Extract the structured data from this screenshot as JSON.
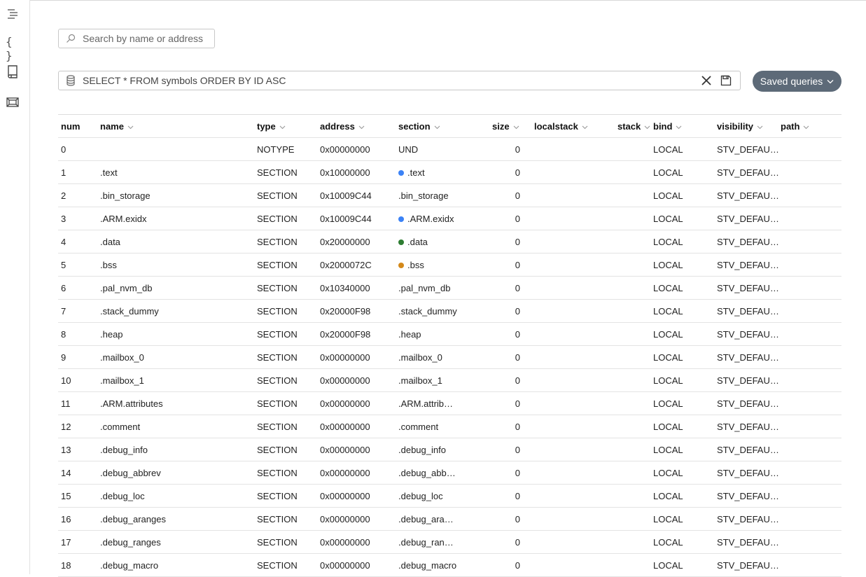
{
  "search": {
    "placeholder": "Search by name or address"
  },
  "query": {
    "value": "SELECT * FROM symbols ORDER BY ID ASC"
  },
  "saved_queries_label": "Saved queries",
  "colors": {
    "text_blue": "#3b82f6",
    "data_green": "#2e7d32",
    "bss_orange": "#d4891a",
    "button_bg": "#5d6a78"
  },
  "columns": {
    "num": "num",
    "name": "name",
    "type": "type",
    "address": "address",
    "section": "section",
    "size": "size",
    "localstack": "localstack",
    "stack": "stack",
    "bind": "bind",
    "visibility": "visibility",
    "path": "path"
  },
  "rows": [
    {
      "num": "0",
      "name": "",
      "type": "NOTYPE",
      "address": "0x00000000",
      "section": "UND",
      "size": "0",
      "bind": "LOCAL",
      "visibility": "STV_DEFAULT"
    },
    {
      "num": "1",
      "name": ".text",
      "type": "SECTION",
      "address": "0x10000000",
      "section": ".text",
      "dot": "#3b82f6",
      "size": "0",
      "bind": "LOCAL",
      "visibility": "STV_DEFAULT"
    },
    {
      "num": "2",
      "name": ".bin_storage",
      "type": "SECTION",
      "address": "0x10009C44",
      "section": ".bin_storage",
      "size": "0",
      "bind": "LOCAL",
      "visibility": "STV_DEFAULT"
    },
    {
      "num": "3",
      "name": ".ARM.exidx",
      "type": "SECTION",
      "address": "0x10009C44",
      "section": ".ARM.exidx",
      "dot": "#3b82f6",
      "size": "0",
      "bind": "LOCAL",
      "visibility": "STV_DEFAULT"
    },
    {
      "num": "4",
      "name": ".data",
      "type": "SECTION",
      "address": "0x20000000",
      "section": ".data",
      "dot": "#2e7d32",
      "size": "0",
      "bind": "LOCAL",
      "visibility": "STV_DEFAULT"
    },
    {
      "num": "5",
      "name": ".bss",
      "type": "SECTION",
      "address": "0x2000072C",
      "section": ".bss",
      "dot": "#d4891a",
      "size": "0",
      "bind": "LOCAL",
      "visibility": "STV_DEFAULT"
    },
    {
      "num": "6",
      "name": ".pal_nvm_db",
      "type": "SECTION",
      "address": "0x10340000",
      "section": ".pal_nvm_db",
      "size": "0",
      "bind": "LOCAL",
      "visibility": "STV_DEFAULT"
    },
    {
      "num": "7",
      "name": ".stack_dummy",
      "type": "SECTION",
      "address": "0x20000F98",
      "section": ".stack_dummy",
      "size": "0",
      "bind": "LOCAL",
      "visibility": "STV_DEFAULT"
    },
    {
      "num": "8",
      "name": ".heap",
      "type": "SECTION",
      "address": "0x20000F98",
      "section": ".heap",
      "size": "0",
      "bind": "LOCAL",
      "visibility": "STV_DEFAULT"
    },
    {
      "num": "9",
      "name": ".mailbox_0",
      "type": "SECTION",
      "address": "0x00000000",
      "section": ".mailbox_0",
      "size": "0",
      "bind": "LOCAL",
      "visibility": "STV_DEFAULT"
    },
    {
      "num": "10",
      "name": ".mailbox_1",
      "type": "SECTION",
      "address": "0x00000000",
      "section": ".mailbox_1",
      "size": "0",
      "bind": "LOCAL",
      "visibility": "STV_DEFAULT"
    },
    {
      "num": "11",
      "name": ".ARM.attributes",
      "type": "SECTION",
      "address": "0x00000000",
      "section": ".ARM.attribu…",
      "size": "0",
      "bind": "LOCAL",
      "visibility": "STV_DEFAULT"
    },
    {
      "num": "12",
      "name": ".comment",
      "type": "SECTION",
      "address": "0x00000000",
      "section": ".comment",
      "size": "0",
      "bind": "LOCAL",
      "visibility": "STV_DEFAULT"
    },
    {
      "num": "13",
      "name": ".debug_info",
      "type": "SECTION",
      "address": "0x00000000",
      "section": ".debug_info",
      "size": "0",
      "bind": "LOCAL",
      "visibility": "STV_DEFAULT"
    },
    {
      "num": "14",
      "name": ".debug_abbrev",
      "type": "SECTION",
      "address": "0x00000000",
      "section": ".debug_abbr…",
      "size": "0",
      "bind": "LOCAL",
      "visibility": "STV_DEFAULT"
    },
    {
      "num": "15",
      "name": ".debug_loc",
      "type": "SECTION",
      "address": "0x00000000",
      "section": ".debug_loc",
      "size": "0",
      "bind": "LOCAL",
      "visibility": "STV_DEFAULT"
    },
    {
      "num": "16",
      "name": ".debug_aranges",
      "type": "SECTION",
      "address": "0x00000000",
      "section": ".debug_aran…",
      "size": "0",
      "bind": "LOCAL",
      "visibility": "STV_DEFAULT"
    },
    {
      "num": "17",
      "name": ".debug_ranges",
      "type": "SECTION",
      "address": "0x00000000",
      "section": ".debug_rang…",
      "size": "0",
      "bind": "LOCAL",
      "visibility": "STV_DEFAULT"
    },
    {
      "num": "18",
      "name": ".debug_macro",
      "type": "SECTION",
      "address": "0x00000000",
      "section": ".debug_macro",
      "size": "0",
      "bind": "LOCAL",
      "visibility": "STV_DEFAULT"
    }
  ]
}
